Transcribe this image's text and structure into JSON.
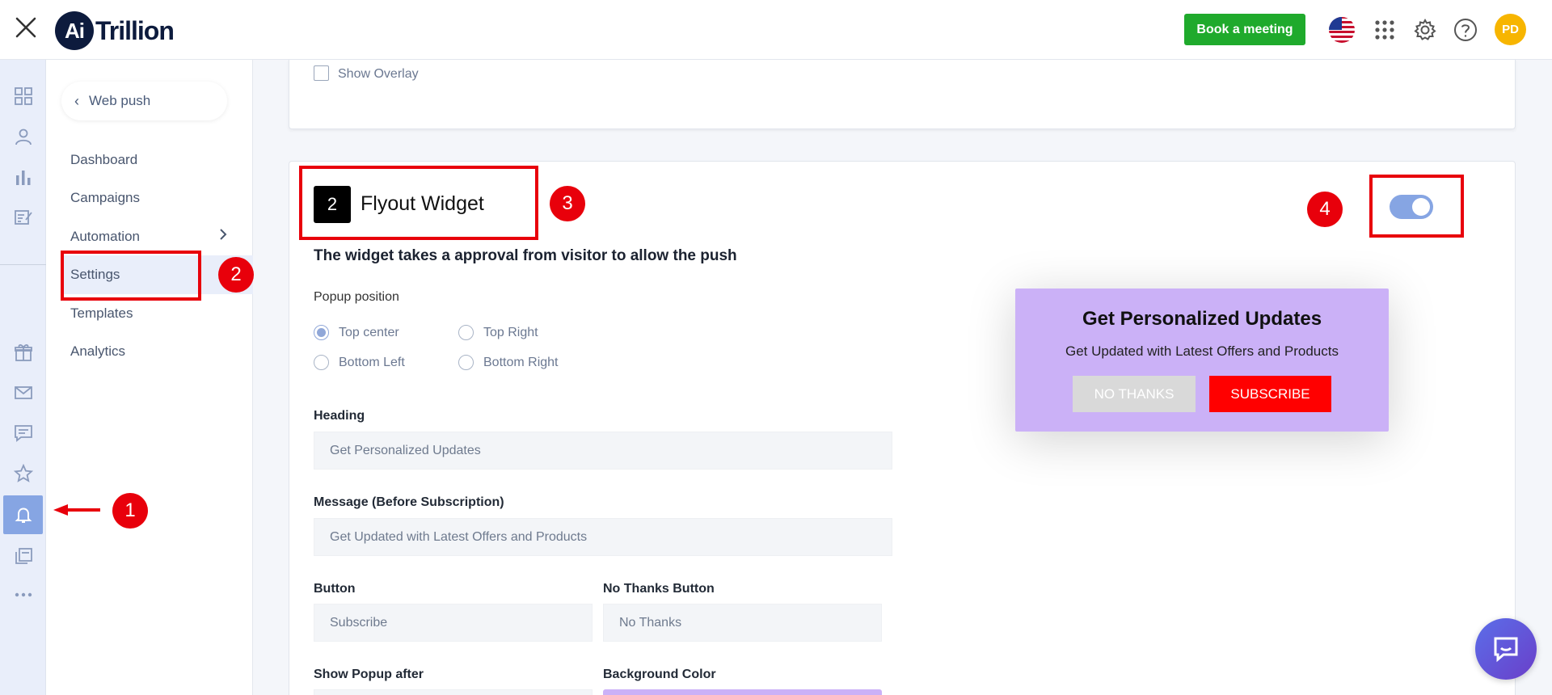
{
  "header": {
    "logo_mark": "Ai",
    "logo_word": "Trillion",
    "book_meeting_label": "Book a meeting",
    "avatar_initials": "PD"
  },
  "sidenav": {
    "back_label": "Web push",
    "items": [
      {
        "label": "Dashboard"
      },
      {
        "label": "Campaigns"
      },
      {
        "label": "Automation"
      },
      {
        "label": "Settings"
      },
      {
        "label": "Templates"
      },
      {
        "label": "Analytics"
      }
    ]
  },
  "section_top": {
    "show_overlay_label": "Show Overlay",
    "show_overlay_checked": false
  },
  "widget": {
    "number": "2",
    "title": "Flyout Widget",
    "description": "The widget takes a approval from visitor to allow the push",
    "enabled": true,
    "popup_position_label": "Popup position",
    "positions": [
      {
        "label": "Top center",
        "selected": true
      },
      {
        "label": "Top Right",
        "selected": false
      },
      {
        "label": "Bottom Left",
        "selected": false
      },
      {
        "label": "Bottom Right",
        "selected": false
      }
    ],
    "heading_label": "Heading",
    "heading_value": "Get Personalized Updates",
    "message_label": "Message (Before Subscription)",
    "message_value": "Get Updated with Latest Offers and Products",
    "button_label": "Button",
    "button_value": "Subscribe",
    "no_thanks_label": "No Thanks Button",
    "no_thanks_value": "No Thanks",
    "show_after_label": "Show Popup after",
    "bg_color_label": "Background Color",
    "bg_color": "#cbb1f7"
  },
  "preview": {
    "heading": "Get Personalized Updates",
    "message": "Get Updated with Latest Offers and Products",
    "no_thanks": "NO THANKS",
    "subscribe": "SUBSCRIBE"
  },
  "annotations": [
    "1",
    "2",
    "3",
    "4"
  ],
  "colors": {
    "accent": "#86a5e3",
    "book_button": "#1faa2c",
    "annotation_red": "#e8000b",
    "subscribe_red": "#ff0000",
    "avatar": "#f7b500"
  }
}
